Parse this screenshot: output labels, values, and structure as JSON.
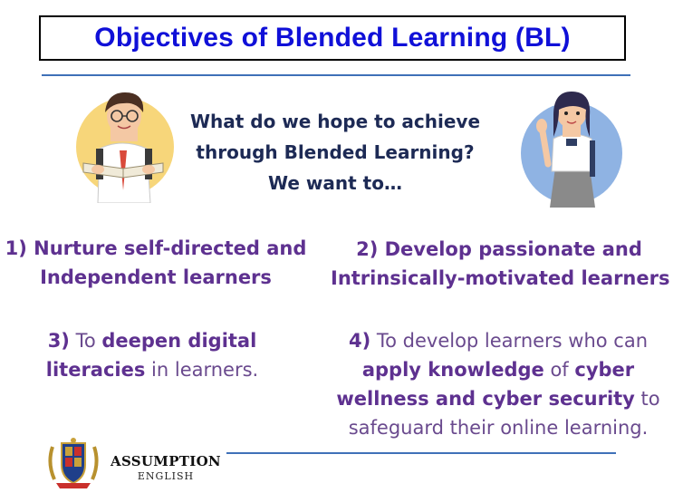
{
  "title": "Objectives of Blended Learning (BL)",
  "question": {
    "line1": "What do we hope to achieve",
    "line2": "through Blended Learning?",
    "line3": "We want to…"
  },
  "objectives": {
    "o1": {
      "line1": "1) Nurture self-directed and",
      "line2": "Independent learners"
    },
    "o2": {
      "line1": "2) Develop passionate and",
      "line2": "Intrinsically-motivated learners"
    },
    "o3": {
      "num": "3)",
      "to": " To ",
      "deepen": "deepen digital",
      "literacies": "literacies",
      "rest": " in learners."
    },
    "o4": {
      "num": "4)",
      "intro": " To develop learners who can",
      "apply": "apply knowledge",
      "of": " of ",
      "cyber": "cyber",
      "wellness": "wellness and cyber security",
      "to": " to",
      "last": "safeguard their online learning."
    }
  },
  "illustrations": {
    "boy": "student-boy-reading",
    "girl": "student-girl-waving"
  },
  "brand": {
    "name": "ASSUMPTION",
    "sub": "ENGLISH",
    "logo": "school-crest-icon"
  },
  "colors": {
    "title": "#1010d8",
    "question": "#1d2a55",
    "objective": "#5e3190",
    "rule": "#3f71b8"
  }
}
